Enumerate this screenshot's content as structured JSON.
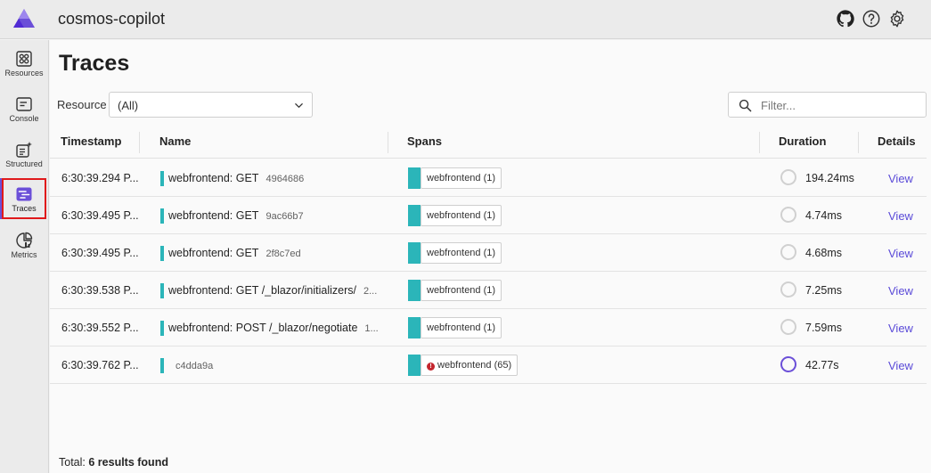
{
  "header": {
    "app_title": "cosmos-copilot"
  },
  "nav": {
    "items": [
      {
        "label": "Resources",
        "icon": "grid-icon"
      },
      {
        "label": "Console",
        "icon": "console-icon"
      },
      {
        "label": "Structured",
        "icon": "structured-logs-icon"
      },
      {
        "label": "Traces",
        "icon": "traces-icon",
        "active": true
      },
      {
        "label": "Metrics",
        "icon": "metrics-icon"
      }
    ]
  },
  "page": {
    "title": "Traces",
    "resource_label": "Resource",
    "resource_value": "(All)",
    "filter_placeholder": "Filter..."
  },
  "table": {
    "columns": [
      "Timestamp",
      "Name",
      "Spans",
      "Duration",
      "Details"
    ],
    "rows": [
      {
        "timestamp": "6:30:39.294 P...",
        "name": "webfrontend: GET",
        "trace_id": "4964686",
        "span": "webfrontend (1)",
        "error": false,
        "duration": "194.24ms",
        "link": "View"
      },
      {
        "timestamp": "6:30:39.495 P...",
        "name": "webfrontend: GET",
        "trace_id": "9ac66b7",
        "span": "webfrontend (1)",
        "error": false,
        "duration": "4.74ms",
        "link": "View"
      },
      {
        "timestamp": "6:30:39.495 P...",
        "name": "webfrontend: GET",
        "trace_id": "2f8c7ed",
        "span": "webfrontend (1)",
        "error": false,
        "duration": "4.68ms",
        "link": "View"
      },
      {
        "timestamp": "6:30:39.538 P...",
        "name": "webfrontend: GET /_blazor/initializers/",
        "trace_id": "2...",
        "span": "webfrontend (1)",
        "error": false,
        "duration": "7.25ms",
        "link": "View"
      },
      {
        "timestamp": "6:30:39.552 P...",
        "name": "webfrontend: POST /_blazor/negotiate",
        "trace_id": "1...",
        "span": "webfrontend (1)",
        "error": false,
        "duration": "7.59ms",
        "link": "View"
      },
      {
        "timestamp": "6:30:39.762 P...",
        "name": "",
        "trace_id": "c4dda9a",
        "span": "webfrontend (65)",
        "error": true,
        "duration": "42.77s",
        "link": "View"
      }
    ]
  },
  "footer": {
    "total_prefix": "Total:",
    "total_value": "6 results found"
  },
  "colors": {
    "accent": "#6b4fd8",
    "span_teal": "#2bb5b9",
    "error": "#c4262e",
    "highlight_border": "#e0191b"
  }
}
